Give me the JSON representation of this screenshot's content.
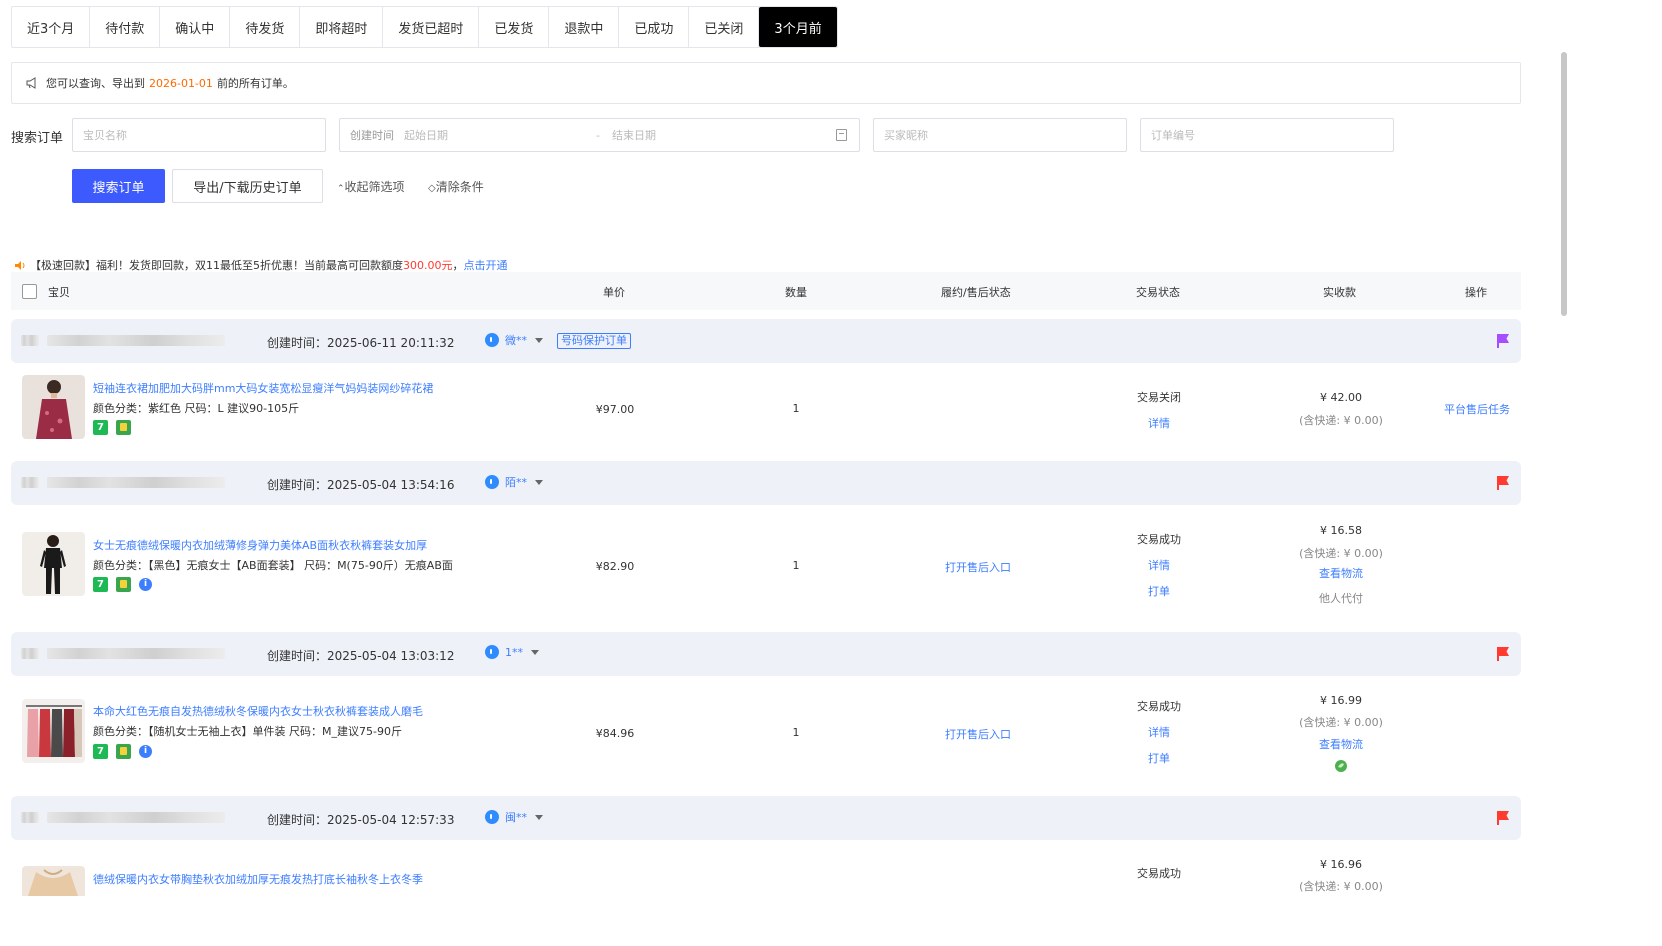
{
  "tabs": [
    {
      "label": "近3个月",
      "active": false
    },
    {
      "label": "待付款",
      "active": false
    },
    {
      "label": "确认中",
      "active": false
    },
    {
      "label": "待发货",
      "active": false
    },
    {
      "label": "即将超时",
      "active": false
    },
    {
      "label": "发货已超时",
      "active": false
    },
    {
      "label": "已发货",
      "active": false
    },
    {
      "label": "退款中",
      "active": false
    },
    {
      "label": "已成功",
      "active": false
    },
    {
      "label": "已关闭",
      "active": false
    },
    {
      "label": "3个月前",
      "active": true
    }
  ],
  "notice": {
    "prefix": "您可以查询、导出到",
    "date": "2026-01-01",
    "suffix": "前的所有订单。"
  },
  "search": {
    "label": "搜索订单",
    "item_placeholder": "宝贝名称",
    "created_label": "创建时间",
    "start_placeholder": "起始日期",
    "range_sep": "-",
    "end_placeholder": "结束日期",
    "buyer_placeholder": "买家昵称",
    "order_placeholder": "订单编号",
    "search_button": "搜索订单",
    "export_button": "导出/下载历史订单",
    "collapse_link": "收起筛选项",
    "clear_link": "清除条件"
  },
  "promo": {
    "prefix": "【极速回款】福利！发货即回款，双11最低至5折优惠！当前最高可回款额度",
    "amount": "300.00元",
    "sep": "，",
    "link": "点击开通"
  },
  "table_header": {
    "item": "宝贝",
    "price": "单价",
    "qty": "数量",
    "aftersale": "履约/售后状态",
    "trade_status": "交易状态",
    "paid": "实收款",
    "ops": "操作"
  },
  "orders": [
    {
      "created": "创建时间：2025-06-11 20:11:32",
      "buyer": "微**",
      "badge": "号码保护订单",
      "flag_color": "#a64dff",
      "title": "短袖连衣裙加肥加大码胖mm大码女装宽松显瘦洋气妈妈装网纱碎花裙",
      "sku": "颜色分类：紫红色   尺码：L 建议90-105斤",
      "price": "¥97.00",
      "qty": "1",
      "aftersale": "",
      "status": "交易关闭",
      "detail": "详情",
      "print": "",
      "paid": "¥ 42.00",
      "shipping": "(含快递: ¥ 0.00)",
      "logistics": "",
      "extra": "",
      "op": "平台售后任务"
    },
    {
      "created": "创建时间：2025-05-04 13:54:16",
      "buyer": "陌**",
      "badge": "",
      "flag_color": "#ff3b30",
      "title": "女士无痕德绒保暖内衣加绒薄修身弹力美体AB面秋衣秋裤套装女加厚",
      "sku": "颜色分类：【黑色】无痕女士【AB面套装】   尺码：M(75-90斤）无痕AB面",
      "price": "¥82.90",
      "qty": "1",
      "aftersale": "打开售后入口",
      "status": "交易成功",
      "detail": "详情",
      "print": "打单",
      "paid": "¥ 16.58",
      "shipping": "(含快递: ¥ 0.00)",
      "logistics": "查看物流",
      "extra": "他人代付",
      "op": ""
    },
    {
      "created": "创建时间：2025-05-04 13:03:12",
      "buyer": "1**",
      "badge": "",
      "flag_color": "#ff3b30",
      "title": "本命大红色无痕自发热德绒秋冬保暖内衣女士秋衣秋裤套装成人磨毛",
      "sku": "颜色分类：【随机女士无袖上衣】单件装   尺码：M_建议75-90斤",
      "price": "¥84.96",
      "qty": "1",
      "aftersale": "打开售后入口",
      "status": "交易成功",
      "detail": "详情",
      "print": "打单",
      "paid": "¥ 16.99",
      "shipping": "(含快递: ¥ 0.00)",
      "logistics": "查看物流",
      "extra": "",
      "op": ""
    },
    {
      "created": "创建时间：2025-05-04 12:57:33",
      "buyer": "闽**",
      "badge": "",
      "flag_color": "#ff3b30",
      "title": "德绒保暖内衣女带胸垫秋衣加绒加厚无痕发热打底长袖秋冬上衣冬季",
      "sku": "",
      "price": "",
      "qty": "",
      "aftersale": "",
      "status": "交易成功",
      "detail": "",
      "print": "",
      "paid": "¥ 16.96",
      "shipping": "(含快递: ¥ 0.00)",
      "logistics": "",
      "extra": "",
      "op": ""
    }
  ]
}
